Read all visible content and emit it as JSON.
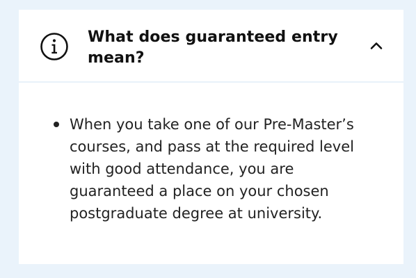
{
  "accordion": {
    "title": "What does guaranteed entry mean?",
    "expanded": true,
    "header_icon": "info-icon",
    "toggle_icon": "chevron-up-icon",
    "body": {
      "bullets": [
        "When you take one of our Pre-Master’s courses, and pass at the required level with good attendance, you are guaranteed a place on your chosen postgraduate degree at university."
      ]
    }
  },
  "colors": {
    "page_background": "#eaf3fb",
    "card_background": "#ffffff",
    "divider": "#e8f1f9",
    "text": "#222222",
    "heading": "#111111"
  }
}
